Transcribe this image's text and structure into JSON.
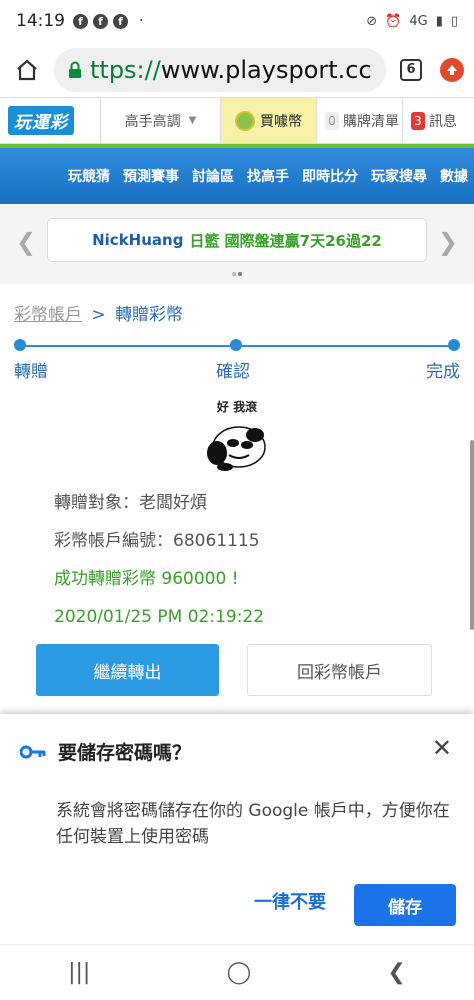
{
  "status_bar": {
    "time": "14:19",
    "dot": "·",
    "network": "4G"
  },
  "browser": {
    "url_scheme": "https://",
    "url_domain": "www.playsport.cc",
    "url_display_scheme": "ttps://",
    "tab_count": "6"
  },
  "site_header": {
    "logo": "玩運彩",
    "menu_label": "高手高調",
    "buy_label": "買噱幣",
    "cart_count": "0",
    "cart_label": "購牌清單",
    "msg_count": "3",
    "msg_label": "訊息"
  },
  "nav_items": [
    "玩競猜",
    "預測賽事",
    "討論區",
    "找高手",
    "即時比分",
    "玩家搜尋",
    "數據"
  ],
  "banner": {
    "who": "NickHuang",
    "rest": "日籃 國際盤連贏7天26過22"
  },
  "breadcrumb": {
    "root": "彩幣帳戶",
    "separator": ">",
    "current": "轉贈彩幣"
  },
  "steps": [
    "轉贈",
    "確認",
    "完成"
  ],
  "sticker_caption": "好 我滾",
  "transfer": {
    "target": "轉贈對象：老闆好煩",
    "account_no": "彩幣帳戶編號：68061115",
    "success": "成功轉贈彩幣 960000 !",
    "timestamp": "2020/01/25 PM 02:19:22"
  },
  "buttons": {
    "continue": "繼續轉出",
    "back": "回彩幣帳戶"
  },
  "password_dialog": {
    "title": "要儲存密碼嗎？",
    "body": "系統會將密碼儲存在你的 Google 帳戶中，方便你在任何裝置上使用密碼",
    "never": "一律不要",
    "save": "儲存"
  },
  "colors": {
    "accent": "#2d9be3",
    "success": "#3aa02b",
    "link": "#2a6db7",
    "google_blue": "#1a73e8"
  }
}
